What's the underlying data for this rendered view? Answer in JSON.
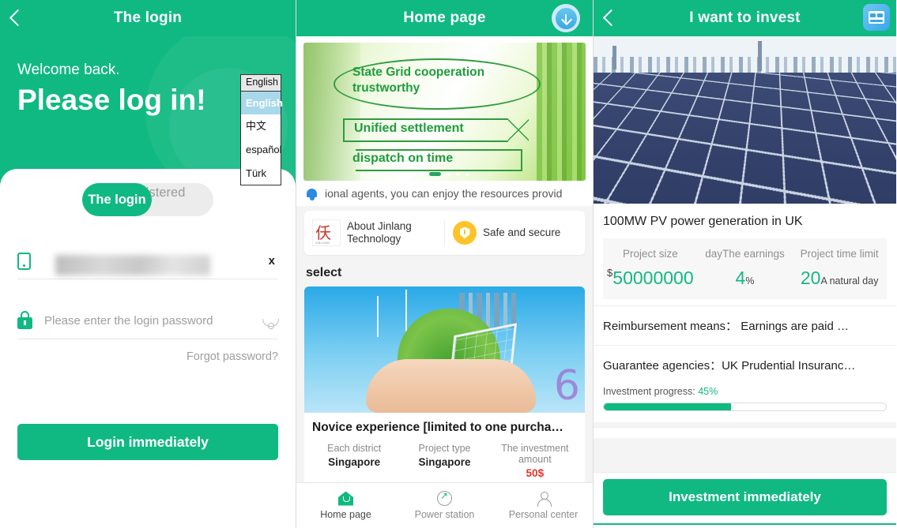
{
  "login": {
    "header_title": "The login",
    "back_icon": "chevron-left-icon",
    "welcome": "Welcome back.",
    "headline": "Please log in!",
    "language": {
      "selected": "English",
      "options": [
        "English",
        "中文",
        "español",
        "Türk"
      ]
    },
    "tabs": {
      "login": "The login",
      "register": "registered"
    },
    "phone": {
      "value": "",
      "clear": "x",
      "icon": "phone-icon"
    },
    "password": {
      "placeholder": "Please enter the login password",
      "icon": "lock-icon"
    },
    "forgot": "Forgot password?",
    "submit": "Login immediately"
  },
  "home": {
    "header_title": "Home page",
    "download_icon": "download-circle-icon",
    "banner": {
      "line1": "State Grid cooperation trustworthy",
      "line2": "Unified settlement",
      "line3": "dispatch on time"
    },
    "notice": "ional agents, you can enjoy the resources provid",
    "cards": [
      {
        "label": "About Jinlang Technology",
        "icon": "jinlong-logo-icon"
      },
      {
        "label": "Safe and secure",
        "icon": "shield-icon"
      }
    ],
    "section_title": "select",
    "product": {
      "name": "Novice experience [limited to one purcha…",
      "meta": [
        {
          "label": "Each district",
          "value": "Singapore"
        },
        {
          "label": "Project type",
          "value": "Singapore"
        },
        {
          "label": "The investment amount",
          "value": "50$"
        }
      ]
    },
    "tabbar": [
      {
        "label": "Home page",
        "icon": "home-icon",
        "active": true
      },
      {
        "label": "Power station",
        "icon": "power-station-icon",
        "active": false
      },
      {
        "label": "Personal center",
        "icon": "user-icon",
        "active": false
      }
    ]
  },
  "invest": {
    "header_title": "I want to invest",
    "back_icon": "chevron-left-icon",
    "app_icon": "calculator-app-icon",
    "project_title": "100MW PV power generation in UK",
    "stats": [
      {
        "label": "Project size",
        "currency": "$",
        "value": "50000000",
        "unit": ""
      },
      {
        "label": "dayThe earnings",
        "currency": "",
        "value": "4",
        "unit": "%"
      },
      {
        "label": "Project time limit",
        "currency": "",
        "value": "20",
        "unit": "A natural day"
      }
    ],
    "reimbursement": "Reimbursement means：  Earnings are paid …",
    "guarantee": "Guarantee agencies：UK Prudential Insuranc…",
    "progress_label": "Investment progress:",
    "progress_value": "45%",
    "progress_pct": 45,
    "cta": "Investment immediately"
  },
  "colors": {
    "brand": "#10b981",
    "accent_blue": "#37a8e8",
    "warn": "#ffc328",
    "danger": "#e8342b"
  }
}
